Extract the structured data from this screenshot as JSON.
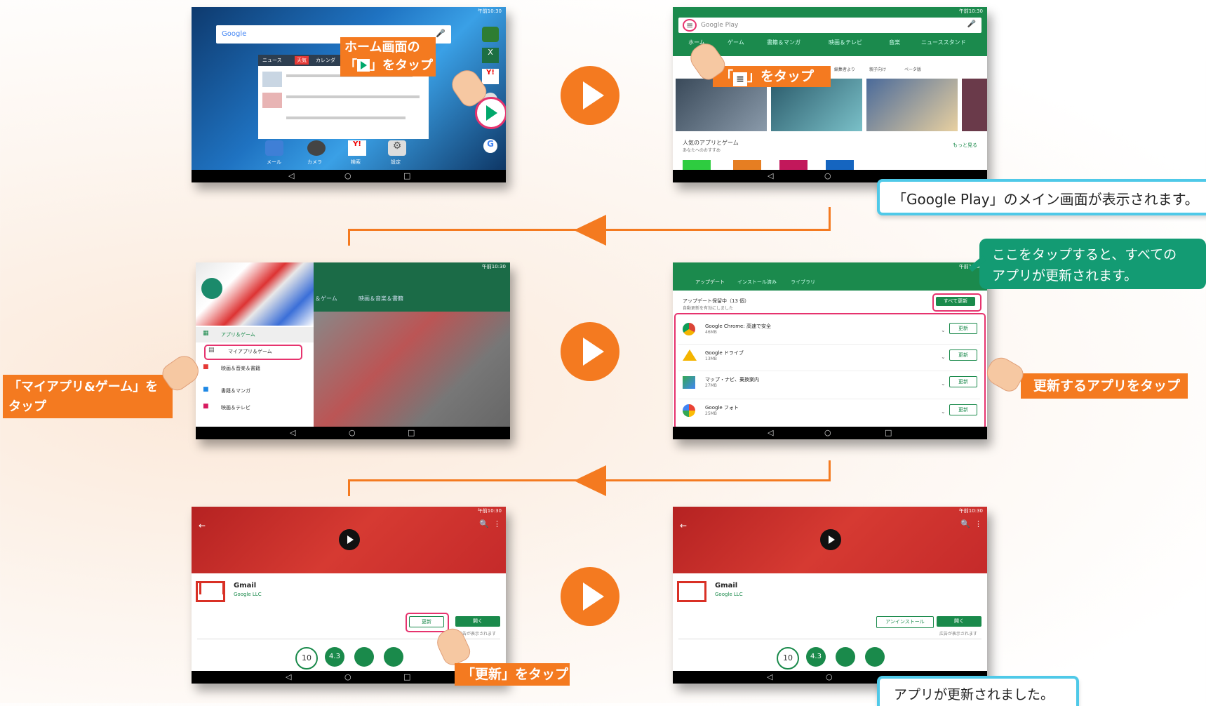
{
  "step1": {
    "search_logo": "Google",
    "widget_tabs": [
      "ニュース",
      "天気",
      "カレンダ"
    ],
    "dock": [
      "メール",
      "カメラ",
      "検索",
      "設定"
    ],
    "status_time": "午前10:30",
    "label_line1": "ホーム画面の",
    "label_line2_pre": "「",
    "label_line2_post": "」をタップ"
  },
  "step2": {
    "search_placeholder": "Google Play",
    "tabs": [
      "ホーム",
      "ゲーム",
      "書籍＆マンガ",
      "映画＆テレビ",
      "音楽",
      "ニューススタンド"
    ],
    "chips": [
      "編集者より",
      "親子向け",
      "ベータ版"
    ],
    "section_title": "人気のアプリとゲーム",
    "section_sub": "あなたへのおすすめ",
    "more": "もっと見る",
    "label_pre": "「",
    "label_post": "」をタップ",
    "callout": "「Google Play」のメイン画面が表示されます。"
  },
  "step3": {
    "header_tabs": [
      "＆ゲーム",
      "映画＆音楽＆書籍"
    ],
    "menu": [
      "アプリ＆ゲーム",
      "マイアプリ＆ゲーム",
      "映画＆音楽＆書籍",
      "書籍＆マンガ",
      "映画＆テレビ"
    ],
    "label_line1": "「マイアプリ&ゲーム」を",
    "label_line2": "タップ"
  },
  "step4": {
    "tabs": [
      "アップデート",
      "インストール済み",
      "ライブラリ"
    ],
    "pending": "アップデート保留中（13 個）",
    "auto": "自動更新を有効にしました",
    "update_all": "すべて更新",
    "apps": [
      {
        "name": "Google Chrome: 高速で安全",
        "size": "46MB"
      },
      {
        "name": "Google ドライブ",
        "size": "13MB"
      },
      {
        "name": "マップ・ナビ、乗換案内",
        "size": "27MB"
      },
      {
        "name": "Google フォト",
        "size": "25MB"
      }
    ],
    "update_btn": "更新",
    "callout_line1": "ここをタップすると、すべての",
    "callout_line2": "アプリが更新されます。",
    "label": "更新するアプリをタップ"
  },
  "step5": {
    "app_name": "Gmail",
    "developer": "Google LLC",
    "update": "更新",
    "open": "開く",
    "ads": "広告が表示されます",
    "downloads": "10",
    "rating": "4.3",
    "label": "「更新」をタップ"
  },
  "step6": {
    "app_name": "Gmail",
    "developer": "Google LLC",
    "uninstall": "アンインストール",
    "open": "開く",
    "ads": "広告が表示されます",
    "downloads": "10",
    "rating": "4.3",
    "callout": "アプリが更新されました。"
  },
  "colors": {
    "accent": "#f47a20",
    "play_green": "#1a8a4b",
    "highlight": "#e6336e",
    "callout_blue": "#4fc9e8",
    "callout_green": "#139b73"
  }
}
